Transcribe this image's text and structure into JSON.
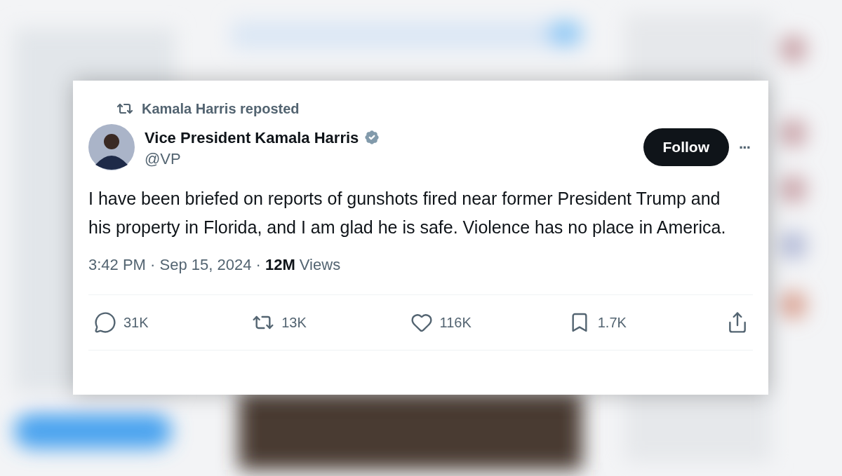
{
  "repost_notice": "Kamala Harris reposted",
  "author": {
    "name": "Vice President Kamala Harris",
    "verified": true,
    "handle": "@VP"
  },
  "follow_button": "Follow",
  "more_button": "···",
  "text": "I have been briefed on reports of gunshots fired near former President Trump and his property in Florida, and I am glad he is safe. Violence has no place in America.",
  "meta": "3:42 PM · Sep 15, 2024 · **12M** Views",
  "actions": [
    {
      "kind": "reply",
      "count": "31K"
    },
    {
      "kind": "repost",
      "count": "13K"
    },
    {
      "kind": "like",
      "count": "116K"
    },
    {
      "kind": "bookmark",
      "count": "1.7K"
    },
    {
      "kind": "share"
    }
  ]
}
